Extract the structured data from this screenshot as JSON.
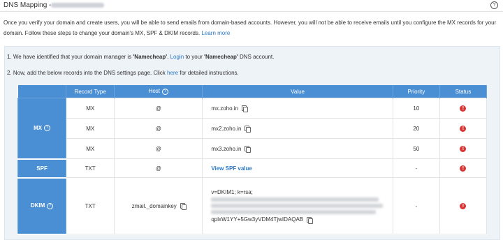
{
  "header": {
    "title": "DNS Mapping -",
    "help_icon": "question-circle-icon"
  },
  "intro": {
    "text_1": "Once you verify your domain and create users, you will be able to send emails from domain-based accounts. However, you will not be able to receive emails until you configure the MX records for your domain. Follow these steps to change your domain's MX, SPF & DKIM records.",
    "learn_more": "Learn more"
  },
  "steps": {
    "step1_prefix": "1. We have identified that your domain manager is ",
    "step1_manager": "'Namecheap'",
    "step1_mid": ". ",
    "step1_login": "Login",
    "step1_suffix_a": " to your ",
    "step1_suffix_b": " DNS account.",
    "step2_prefix": "2. Now, add the below records into the DNS settings page. Click ",
    "step2_here": "here",
    "step2_suffix": " for detailed instructions."
  },
  "table": {
    "headers": {
      "record_type": "Record Type",
      "host": "Host",
      "value": "Value",
      "priority": "Priority",
      "status": "Status"
    },
    "groups": {
      "mx": "MX",
      "spf": "SPF",
      "dkim": "DKIM"
    },
    "rows": [
      {
        "type": "MX",
        "host": "@",
        "value": "mx.zoho.in",
        "priority": "10"
      },
      {
        "type": "MX",
        "host": "@",
        "value": "mx2.zoho.in",
        "priority": "20"
      },
      {
        "type": "MX",
        "host": "@",
        "value": "mx3.zoho.in",
        "priority": "50"
      },
      {
        "type": "TXT",
        "host": "@",
        "value": "View SPF value",
        "priority": "-"
      },
      {
        "type": "TXT",
        "host": "zmail._domainkey",
        "value_line1": "v=DKIM1; k=rsa;",
        "value_last": "qplxW1YY+5Gw3yVDM4TjwIDAQAB",
        "priority": "-"
      }
    ],
    "status_icon": "error-icon",
    "status_color": "#d83535",
    "header_color": "#4a8fd3"
  }
}
